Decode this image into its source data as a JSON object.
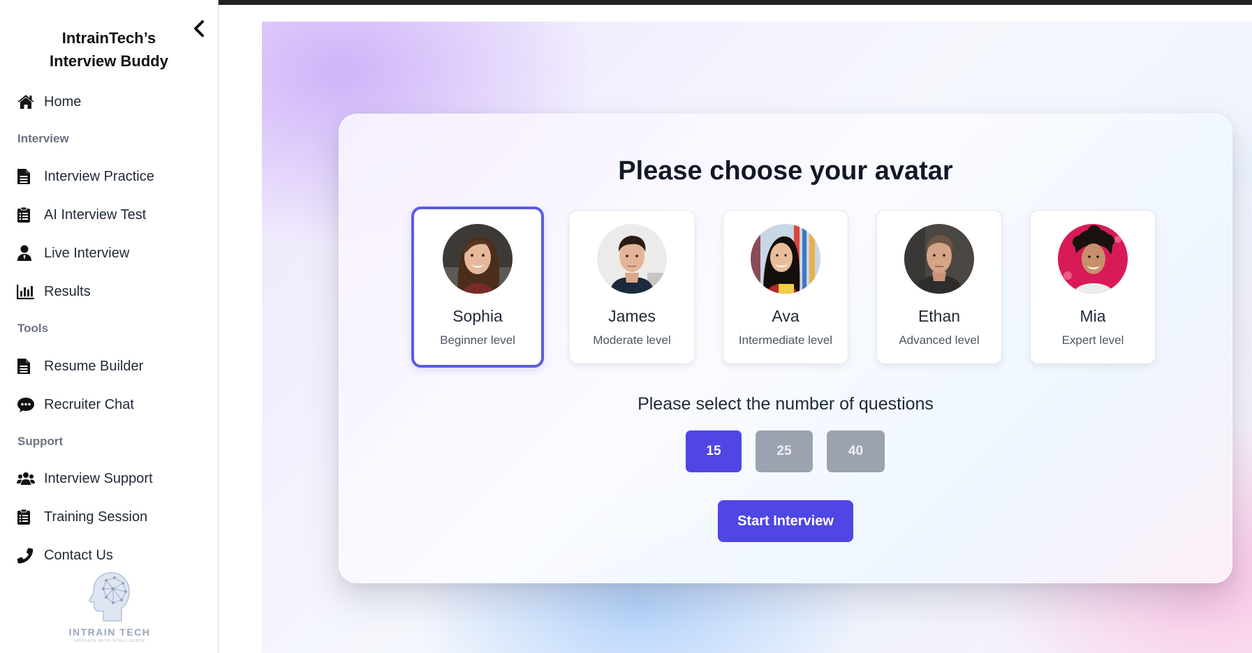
{
  "sidebar": {
    "brand_line1": "IntrainTech’s",
    "brand_line2": "Interview Buddy",
    "home": "Home",
    "sections": {
      "interview": "Interview",
      "tools": "Tools",
      "support": "Support"
    },
    "items": {
      "interview_practice": "Interview Practice",
      "ai_interview_test": "AI Interview Test",
      "live_interview": "Live Interview",
      "results": "Results",
      "resume_builder": "Resume Builder",
      "recruiter_chat": "Recruiter Chat",
      "interview_support": "Interview Support",
      "training_session": "Training Session",
      "contact_us": "Contact Us"
    },
    "logo": {
      "name": "INTRAIN TECH",
      "tagline": "INNOVATE WITH INTELLIGENCE"
    }
  },
  "main": {
    "title": "Please choose your avatar",
    "avatars": [
      {
        "name": "Sophia",
        "level": "Beginner level",
        "selected": true
      },
      {
        "name": "James",
        "level": "Moderate level",
        "selected": false
      },
      {
        "name": "Ava",
        "level": "Intermediate level",
        "selected": false
      },
      {
        "name": "Ethan",
        "level": "Advanced level",
        "selected": false
      },
      {
        "name": "Mia",
        "level": "Expert level",
        "selected": false
      }
    ],
    "questions_label": "Please select the number of questions",
    "question_options": [
      "15",
      "25",
      "40"
    ],
    "selected_questions": "15",
    "start_button": "Start Interview"
  },
  "colors": {
    "accent": "#4f46e5",
    "selected_border": "#5b5ce0",
    "inactive_button": "#9ca3af"
  }
}
